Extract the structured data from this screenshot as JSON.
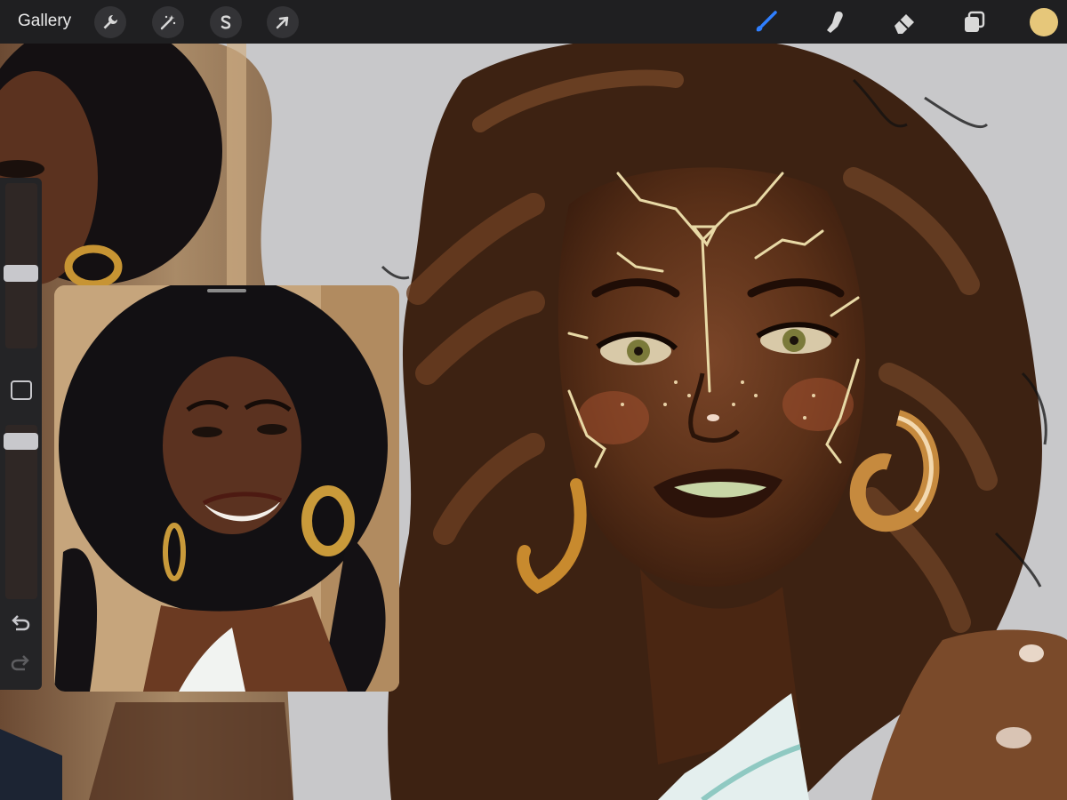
{
  "app": {
    "gallery_label": "Gallery"
  },
  "toolbar": {
    "left_tools": [
      {
        "name": "actions",
        "icon": "wrench-icon"
      },
      {
        "name": "adjustments",
        "icon": "magic-wand-icon"
      },
      {
        "name": "selection",
        "icon": "selection-s-icon"
      },
      {
        "name": "transform",
        "icon": "arrow-cursor-icon"
      }
    ],
    "right_tools": [
      {
        "name": "brush",
        "icon": "brush-icon",
        "active": true
      },
      {
        "name": "smudge",
        "icon": "smudge-finger-icon"
      },
      {
        "name": "eraser",
        "icon": "eraser-icon"
      },
      {
        "name": "layers",
        "icon": "layers-icon"
      }
    ],
    "current_color": "#e6c77a",
    "active_color": "#2f7fff"
  },
  "sidebar": {
    "brush_size_level": 0.55,
    "brush_opacity_level": 0.05,
    "modify_button_icon": "square-icon",
    "undo_icon": "undo-arrow-icon",
    "redo_icon": "redo-arrow-icon"
  },
  "reference": {
    "window": "reference-image-window"
  },
  "colors": {
    "toolbar_bg": "#1f1f21",
    "canvas_bg": "#c9c9cb"
  }
}
